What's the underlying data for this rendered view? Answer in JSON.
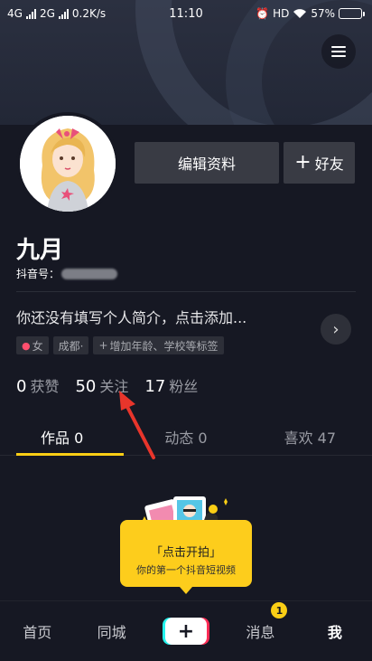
{
  "status_bar": {
    "network_left": "4G",
    "network_right": "2G",
    "speed": "0.2K/s",
    "time": "11:10",
    "hd": "HD",
    "battery": "57%",
    "battery_level": 0.57
  },
  "profile": {
    "nickname": "九月",
    "douyin_id_label": "抖音号：",
    "bio": "你还没有填写个人简介，点击添加...",
    "edit_button": "编辑资料",
    "add_friend_button": "好友",
    "tags": [
      {
        "label": "女",
        "icon": "female-user-icon"
      },
      {
        "label": "成都·"
      },
      {
        "label": "增加年龄、学校等标签",
        "icon": "plus-icon"
      }
    ]
  },
  "stats": [
    {
      "value": "0",
      "label": "获赞"
    },
    {
      "value": "50",
      "label": "关注"
    },
    {
      "value": "17",
      "label": "粉丝"
    }
  ],
  "tabs": [
    {
      "label": "作品 0",
      "active": true
    },
    {
      "label": "动态 0",
      "active": false
    },
    {
      "label": "喜欢 47",
      "active": false
    }
  ],
  "promo": {
    "title": "「点击开拍」",
    "subtitle": "你的第一个抖音短视频"
  },
  "bottom_nav": {
    "home": "首页",
    "city": "同城",
    "publish": "+",
    "messages": "消息",
    "messages_badge": "1",
    "me": "我"
  },
  "colors": {
    "background": "#161823",
    "accent_yellow": "#face15",
    "tiktok_cyan": "#25f4ee",
    "tiktok_red": "#fe2c55",
    "annotation_red": "#e8352b"
  }
}
